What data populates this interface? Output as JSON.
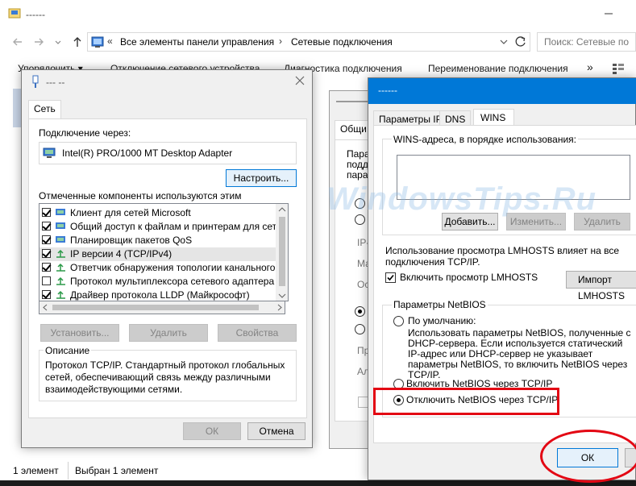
{
  "explorer": {
    "title": "------",
    "address": {
      "crumb1": "Все элементы панели управления",
      "crumb2": "Сетевые подключения",
      "sep": "›"
    },
    "search": {
      "placeholder": "Поиск: Сетевые подкл"
    },
    "commands": {
      "organize": "Упорядочить ▾",
      "disable": "Отключение сетевого устройства",
      "diagnose": "Диагностика подключения",
      "rename": "Переименование подключения",
      "more": "»"
    },
    "status": {
      "count": "1 элемент",
      "selected": "Выбран 1 элемент"
    }
  },
  "eth_dialog": {
    "title": "--- --",
    "tab": "Сеть",
    "connect_using_label": "Подключение через:",
    "adapter_name": "Intel(R) PRO/1000 MT Desktop Adapter",
    "configure_button": "Настроить...",
    "components_label": "Отмеченные компоненты используются этим подключением:",
    "components": [
      {
        "label": "Клиент для сетей Microsoft",
        "checked": true
      },
      {
        "label": "Общий доступ к файлам и принтерам для сетей Mi",
        "checked": true
      },
      {
        "label": "Планировщик пакетов QoS",
        "checked": true
      },
      {
        "label": "IP версии 4 (TCP/IPv4)",
        "checked": true
      },
      {
        "label": "Ответчик обнаружения топологии канального уров",
        "checked": true
      },
      {
        "label": "Протокол мультиплексора сетевого адаптера (Май",
        "checked": false
      },
      {
        "label": "Драйвер протокола LLDP (Майкрософт)",
        "checked": true
      }
    ],
    "install_button": "Установить...",
    "remove_button": "Удалить",
    "properties_button": "Свойства",
    "description_label": "Описание",
    "description_text": "Протокол TCP/IP. Стандартный протокол глобальных сетей, обеспечивающий связь между различными взаимодействующими сетями.",
    "ok_button": "ОК",
    "cancel_button": "Отмена"
  },
  "bg_dialog": {
    "tab": "Общи",
    "text_lines": [
      "Пара",
      "подд",
      "пара"
    ],
    "field_labels": [
      "IP-",
      "Ма",
      "Ос",
      "Пр",
      "Ал"
    ]
  },
  "wins_dialog": {
    "title": "------",
    "tabs": [
      "Параметры IP",
      "DNS",
      "WINS"
    ],
    "wins_label": "WINS-адреса, в порядке использования:",
    "add_button": "Добавить...",
    "edit_button": "Изменить...",
    "remove_button": "Удалить",
    "lmhosts_text": "Использование просмотра LMHOSTS влияет на все подключения TCP/IP.",
    "lmhosts_checkbox": "Включить просмотр LMHOSTS",
    "lmhosts_checked": true,
    "import_button": "Импорт LMHOSTS",
    "netbios_label": "Параметры NetBIOS",
    "netbios_default": "По умолчанию:",
    "netbios_default_desc": "Использовать параметры NetBIOS, полученные с DHCP-сервера. Если используется статический IP-адрес или DHCP-сервер не указывает параметры NetBIOS, то включить NetBIOS через TCP/IP.",
    "netbios_enable": "Включить NetBIOS через TCP/IP",
    "netbios_disable": "Отключить NetBIOS через TCP/IP",
    "selected_option": "disable",
    "ok_button": "ОК"
  },
  "watermark": "WindowsTips.Ru",
  "colors": {
    "accent": "#0078d7",
    "highlight": "#e30613",
    "dialog_bg": "#f0f0f0"
  }
}
